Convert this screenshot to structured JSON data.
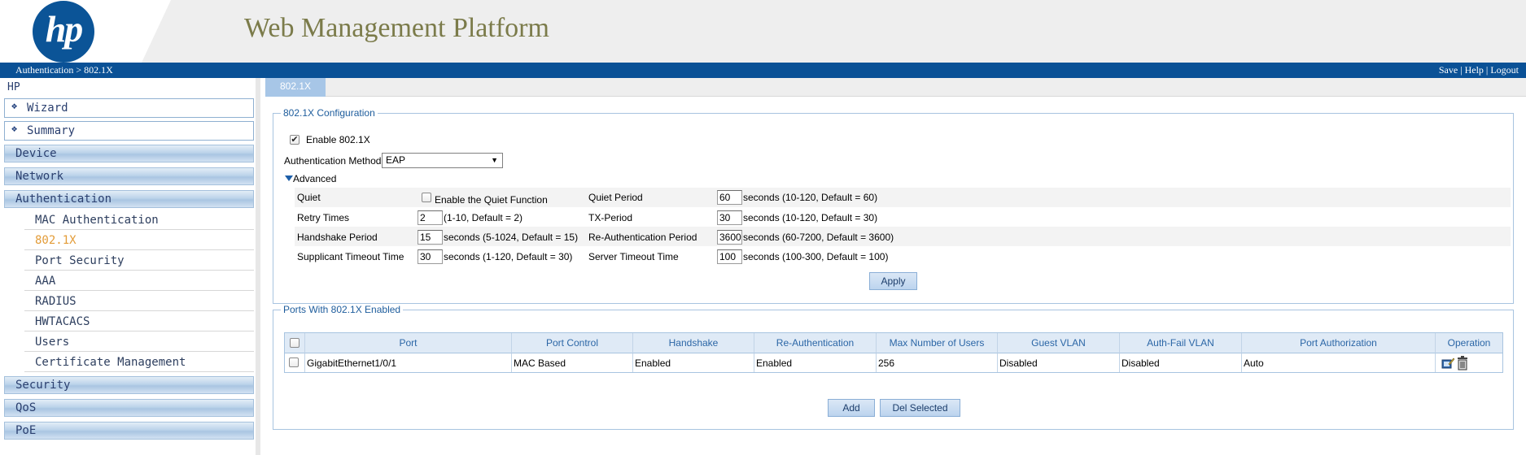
{
  "header": {
    "logo_text": "hp",
    "title": "Web Management Platform",
    "breadcrumb": "Authentication > 802.1X",
    "links": {
      "save": "Save",
      "help": "Help",
      "logout": "Logout",
      "separator": "|"
    }
  },
  "sidebar": {
    "brand": "HP",
    "wizard": "Wizard",
    "summary": "Summary",
    "sections": {
      "device": "Device",
      "network": "Network",
      "authentication": "Authentication",
      "security": "Security",
      "qos": "QoS",
      "poe": "PoE"
    },
    "auth_items": [
      {
        "label": "MAC Authentication"
      },
      {
        "label": "802.1X",
        "active": true
      },
      {
        "label": "Port Security"
      },
      {
        "label": "AAA"
      },
      {
        "label": "RADIUS"
      },
      {
        "label": "HWTACACS"
      },
      {
        "label": "Users"
      },
      {
        "label": "Certificate Management"
      }
    ]
  },
  "tab": {
    "label": "802.1X"
  },
  "config": {
    "legend": "802.1X Configuration",
    "enable_label": "Enable 802.1X",
    "enable_checked": true,
    "auth_method_label": "Authentication Method",
    "auth_method_value": "EAP",
    "advanced_label": "Advanced",
    "quiet_label": "Quiet",
    "quiet_function_label": "Enable the Quiet Function",
    "quiet_function_checked": false,
    "quiet_period_label": "Quiet Period",
    "quiet_period_value": "60",
    "quiet_period_hint": "seconds (10-120, Default = 60)",
    "retry_label": "Retry Times",
    "retry_value": "2",
    "retry_hint": "(1-10, Default = 2)",
    "tx_label": "TX-Period",
    "tx_value": "30",
    "tx_hint": "seconds (10-120, Default = 30)",
    "handshake_label": "Handshake Period",
    "handshake_value": "15",
    "handshake_hint": "seconds (5-1024, Default = 15)",
    "reauth_label": "Re-Authentication Period",
    "reauth_value": "3600",
    "reauth_hint": "seconds (60-7200, Default = 3600)",
    "supp_label": "Supplicant Timeout Time",
    "supp_value": "30",
    "supp_hint": "seconds (1-120, Default = 30)",
    "server_label": "Server Timeout Time",
    "server_value": "100",
    "server_hint": "seconds (100-300, Default = 100)",
    "apply_label": "Apply"
  },
  "ports": {
    "legend": "Ports With 802.1X Enabled",
    "columns": [
      "Port",
      "Port Control",
      "Handshake",
      "Re-Authentication",
      "Max Number of Users",
      "Guest VLAN",
      "Auth-Fail VLAN",
      "Port Authorization",
      "Operation"
    ],
    "rows": [
      {
        "port": "GigabitEthernet1/0/1",
        "port_control": "MAC Based",
        "handshake": "Enabled",
        "reauth": "Enabled",
        "max_users": "256",
        "guest_vlan": "Disabled",
        "auth_fail_vlan": "Disabled",
        "port_authorization": "Auto",
        "operation_icons": [
          "edit-icon",
          "delete-icon"
        ]
      }
    ],
    "add_label": "Add",
    "del_label": "Del Selected"
  }
}
